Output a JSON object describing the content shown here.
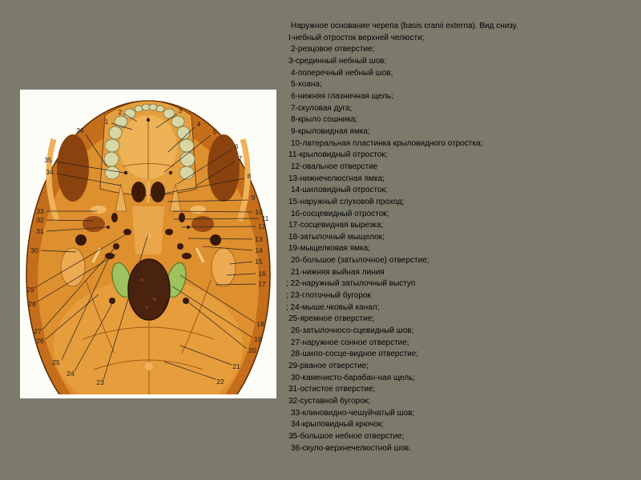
{
  "slide": {
    "title": "Наружное основание черепа (basis cranii externa). Вид снизу.",
    "items": [
      "I-небный отросток верхней челюсти;",
      "2-резцовое отверстие;",
      "3-срединный небный шов;",
      "4-поперечный небный шов;",
      "5-хоана;",
      "6-нижняя глазничная щель;",
      "7-скуловая дуга;",
      "8-крыло сошника;",
      "9-крыловидная ямка;",
      "10-латеральная пластинка крыловидного отростка;",
      "11-крыловидный отросток;",
      "12-овальное отверстие",
      "13-нижнечелюсгная ямка;",
      "14-шиловидный отросток;",
      "15-наружный слуховой проход;",
      "16-сосцевидный отросток;",
      "17-сосцевидная вырезка;",
      "18-затылочный мыщелок;",
      "19-мыщелковая ямка;",
      "20-большое (затылочное) отверстие;",
      "21-нижняя выйная линия",
      "; 22-наружный затылочный выступ",
      "; 23-глоточный бугорок",
      "; 24-мыше.чковый канал;",
      "25-яремное отверстие;",
      "26-затылочносо-сцевидный шов;",
      "27-наружное сонное отверстие;",
      "28-шило-сосце-видное отверстие;",
      "29-рваное отверстие;",
      "30-каменисто-барабан-ная щель;",
      "31-остистое отверстие;",
      "32-суставной бугорок;",
      "33-клиновидно-чешуйчатый шов;",
      "34-крыловидный крючок;",
      "35-большое небное отверстие;",
      "36-скуло-верхнечелюстной шов."
    ]
  },
  "figure": {
    "labels": [
      "1",
      "2",
      "3",
      "4",
      "5",
      "6",
      "7",
      "8",
      "9",
      "10",
      "11",
      "12",
      "13",
      "14",
      "15",
      "16",
      "17",
      "18",
      "19",
      "20",
      "21",
      "22",
      "23",
      "24",
      "25",
      "26",
      "27",
      "28",
      "29",
      "30",
      "31",
      "32",
      "33",
      "34",
      "35",
      "36"
    ]
  },
  "colors": {
    "background": "#7b7a6b",
    "text": "#000000",
    "bone": "#de8f2e",
    "condyle": "#9dc25e"
  }
}
